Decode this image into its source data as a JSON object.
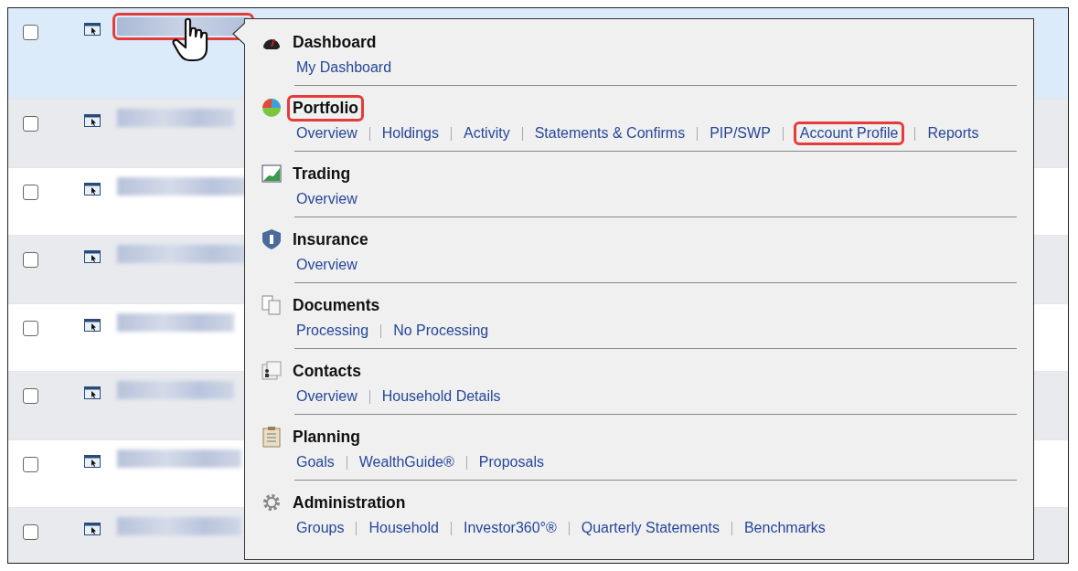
{
  "rows": [
    {
      "selected": true,
      "checked": false,
      "highlighted": true
    },
    {
      "selected": false,
      "checked": false,
      "highlighted": false
    },
    {
      "selected": false,
      "checked": false,
      "highlighted": false
    },
    {
      "selected": false,
      "checked": false,
      "highlighted": false
    },
    {
      "selected": false,
      "checked": false,
      "highlighted": false
    },
    {
      "selected": false,
      "checked": false,
      "highlighted": false
    },
    {
      "selected": false,
      "checked": false,
      "highlighted": false
    },
    {
      "selected": false,
      "checked": false,
      "highlighted": false
    }
  ],
  "menu": {
    "sections": [
      {
        "title": "Dashboard",
        "highlighted": false,
        "links": [
          {
            "label": "My Dashboard",
            "highlighted": false
          }
        ]
      },
      {
        "title": "Portfolio",
        "highlighted": true,
        "links": [
          {
            "label": "Overview",
            "highlighted": false
          },
          {
            "label": "Holdings",
            "highlighted": false
          },
          {
            "label": "Activity",
            "highlighted": false
          },
          {
            "label": "Statements & Confirms",
            "highlighted": false
          },
          {
            "label": "PIP/SWP",
            "highlighted": false
          },
          {
            "label": "Account Profile",
            "highlighted": true
          },
          {
            "label": "Reports",
            "highlighted": false
          }
        ]
      },
      {
        "title": "Trading",
        "highlighted": false,
        "links": [
          {
            "label": "Overview",
            "highlighted": false
          }
        ]
      },
      {
        "title": "Insurance",
        "highlighted": false,
        "links": [
          {
            "label": "Overview",
            "highlighted": false
          }
        ]
      },
      {
        "title": "Documents",
        "highlighted": false,
        "links": [
          {
            "label": "Processing",
            "highlighted": false
          },
          {
            "label": "No Processing",
            "highlighted": false
          }
        ]
      },
      {
        "title": "Contacts",
        "highlighted": false,
        "links": [
          {
            "label": "Overview",
            "highlighted": false
          },
          {
            "label": "Household Details",
            "highlighted": false
          }
        ]
      },
      {
        "title": "Planning",
        "highlighted": false,
        "links": [
          {
            "label": "Goals",
            "highlighted": false
          },
          {
            "label": "WealthGuide®",
            "highlighted": false
          },
          {
            "label": "Proposals",
            "highlighted": false
          }
        ]
      },
      {
        "title": "Administration",
        "highlighted": false,
        "links": [
          {
            "label": "Groups",
            "highlighted": false
          },
          {
            "label": "Household",
            "highlighted": false
          },
          {
            "label": "Investor360°®",
            "highlighted": false
          },
          {
            "label": "Quarterly Statements",
            "highlighted": false
          },
          {
            "label": "Benchmarks",
            "highlighted": false
          }
        ]
      }
    ]
  }
}
